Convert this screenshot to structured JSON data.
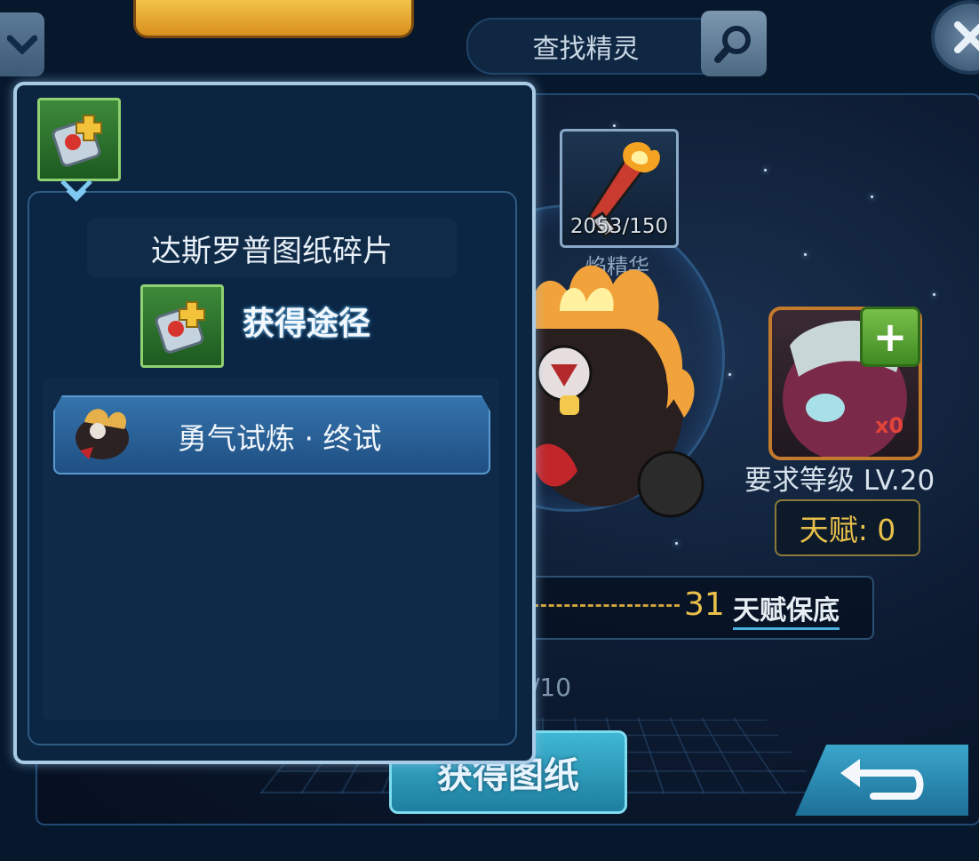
{
  "header": {
    "search_placeholder": "查找精灵",
    "dropdown_icon": "chevron-down-icon",
    "search_icon": "search-icon",
    "close_icon": "close-icon"
  },
  "material": {
    "name": "焰精华",
    "count": "2053/150"
  },
  "pet": {
    "count": "x0",
    "level_requirement": "要求等级 LV.20",
    "talent": "天赋: 0",
    "plus": "+"
  },
  "guarantee": {
    "number": "31",
    "label": "天赋保底"
  },
  "fragments": {
    "progress": "/10"
  },
  "buttons": {
    "get_blueprint": "获得图纸",
    "back_icon": "return-arrow-icon"
  },
  "popup": {
    "item_name": "达斯罗普图纸碎片",
    "source_title": "获得途径",
    "sources": [
      {
        "label": "勇气试炼 · 终试"
      }
    ]
  },
  "colors": {
    "accent_gold": "#e8c04a",
    "panel_border": "#a9cbe6",
    "button_blue": "#3574ad"
  }
}
